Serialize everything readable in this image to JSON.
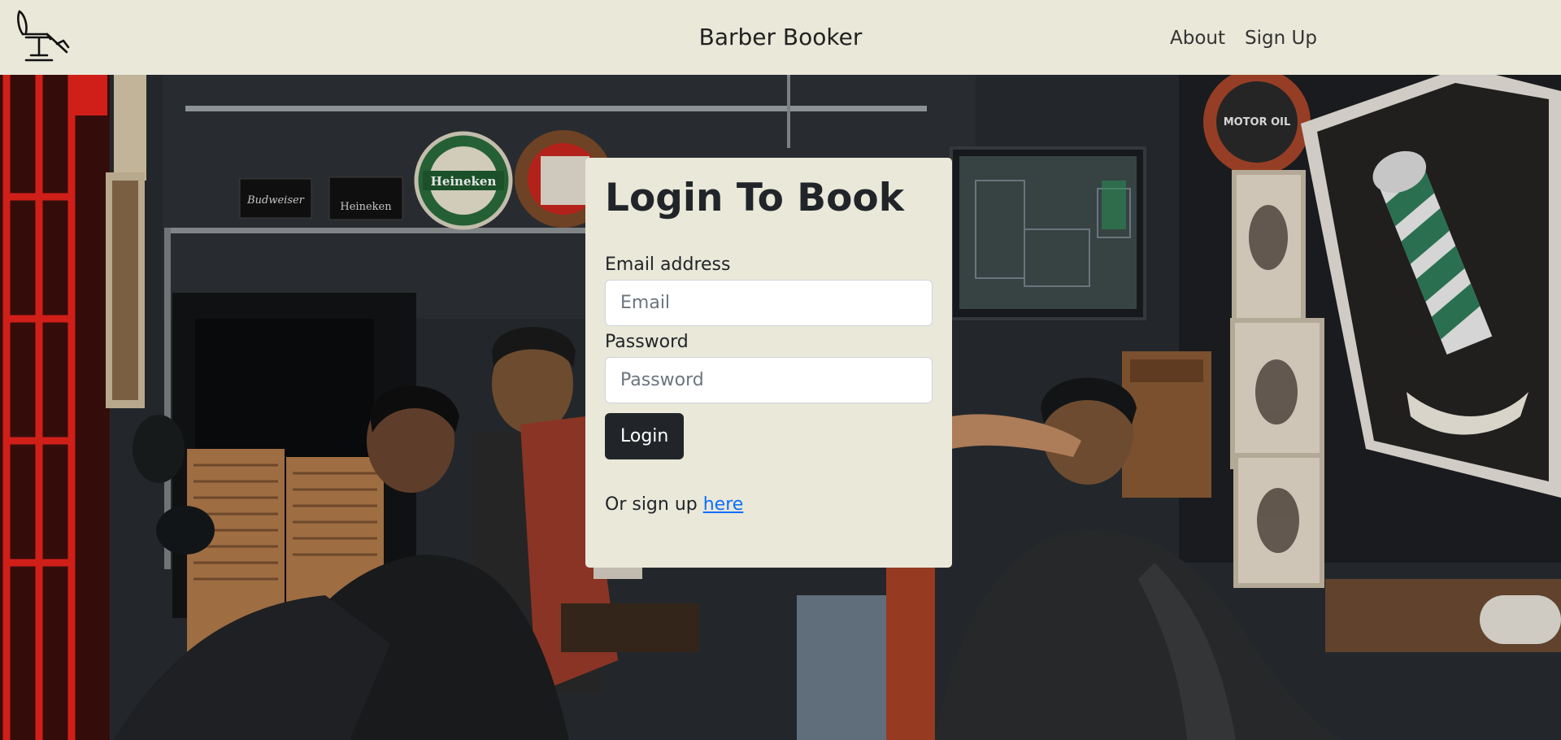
{
  "nav": {
    "brand": "Barber Booker",
    "links": [
      "About",
      "Sign Up"
    ],
    "logo_icon": "barber-chair-icon"
  },
  "login": {
    "title": "Login To Book",
    "email_label": "Email address",
    "email_placeholder": "Email",
    "password_label": "Password",
    "password_placeholder": "Password",
    "button_label": "Login",
    "signup_text": "Or sign up ",
    "signup_link": "here"
  },
  "hero": {
    "sign_1": "Heineken",
    "sign_2": "Budweiser",
    "sign_3": "Heineken",
    "sign_4": "MOTOR OIL"
  },
  "colors": {
    "nav_bg": "#e9e8d9",
    "card_bg": "#e9e8d9",
    "button_bg": "#212529",
    "link": "#0d6efd",
    "door_red": "#e8231c"
  }
}
